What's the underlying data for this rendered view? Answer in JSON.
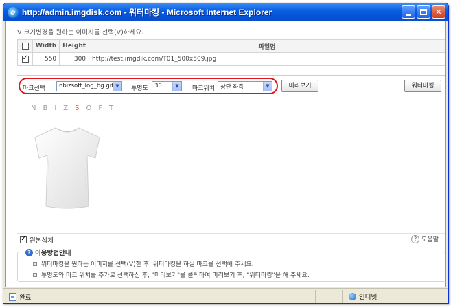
{
  "window": {
    "title": "http://admin.imgdisk.com - 워터마킹 - Microsoft Internet Explorer",
    "icon": "ie-icon"
  },
  "hint": "V 크기변경을 원하는 이미지를 선택(V)하세요.",
  "file_table": {
    "columns": [
      "",
      "Width",
      "Height",
      "파일명"
    ],
    "rows": [
      {
        "checked": true,
        "width": "550",
        "height": "300",
        "filename": "http://test.imgdik.com/T01_500x509.jpg"
      }
    ]
  },
  "toolbar": {
    "mark_label": "마크선택",
    "mark_value": "nbizsoft_log_bg.gif",
    "opacity_label": "투명도",
    "opacity_value": "30",
    "position_label": "마크위치",
    "position_value": "상단 좌측",
    "preview_button": "미리보기",
    "watermark_button": "워터마킹"
  },
  "preview": {
    "logo_text_left": "NBIZ",
    "logo_text_mid": "S",
    "logo_text_right": "OFT",
    "image_subject": "white-tshirt"
  },
  "options": {
    "delete_original_label": "원본삭제",
    "delete_original_checked": true,
    "help_label": "도움말"
  },
  "guide": {
    "title": "이용방법안내",
    "items": [
      "워터마킹을 원하는 이미지를 선택(V)한 후, 워터마킹을 하실 마크를 선택해 주세요.",
      "투명도와 마크 위치를 추가로 선택하신 후, \"미리보기\"를 클릭하여 미리보기 후, \"워터마킹\"을 해 주세요."
    ]
  },
  "statusbar": {
    "status_text": "완료",
    "zone_text": "인터넷"
  },
  "colors": {
    "titlebar": "#0a5fe0",
    "highlight_oval": "#e0141a",
    "info_icon": "#2f6fd0"
  }
}
